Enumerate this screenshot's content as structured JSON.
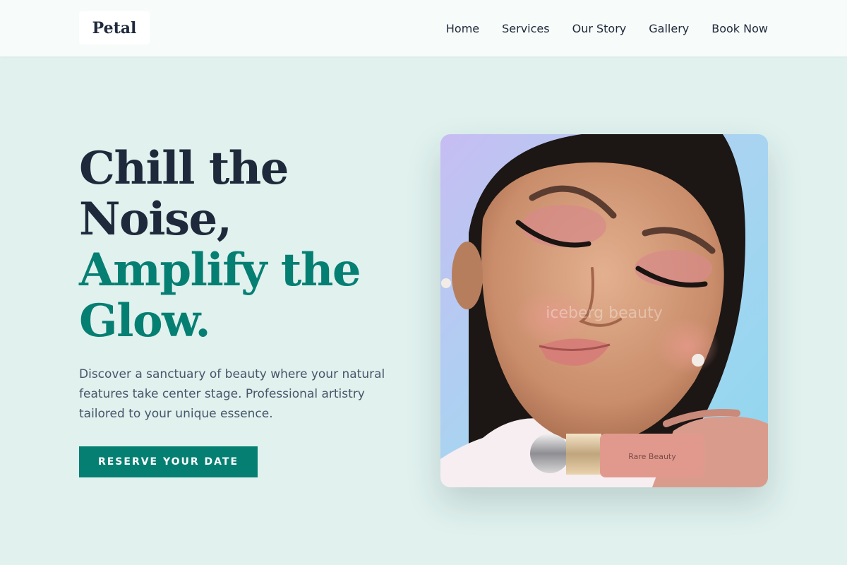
{
  "brand": {
    "name": "Petal"
  },
  "nav": {
    "items": [
      "Home",
      "Services",
      "Our Story",
      "Gallery",
      "Book Now"
    ]
  },
  "hero": {
    "title_line1": "Chill the",
    "title_line2": "Noise,",
    "title_line3": "Amplify the",
    "title_line4": "Glow.",
    "description": "Discover a sanctuary of beauty where your natural features take center stage. Professional artistry tailored to your unique essence.",
    "cta_label": "RESERVE YOUR DATE"
  },
  "photo": {
    "watermark": "iceberg beauty",
    "product_label": "Rare Beauty"
  },
  "colors": {
    "background": "#e0f1ee",
    "header": "#f7fbfa",
    "accent": "#067f73",
    "heading": "#1e293b",
    "body_text": "#475569"
  }
}
